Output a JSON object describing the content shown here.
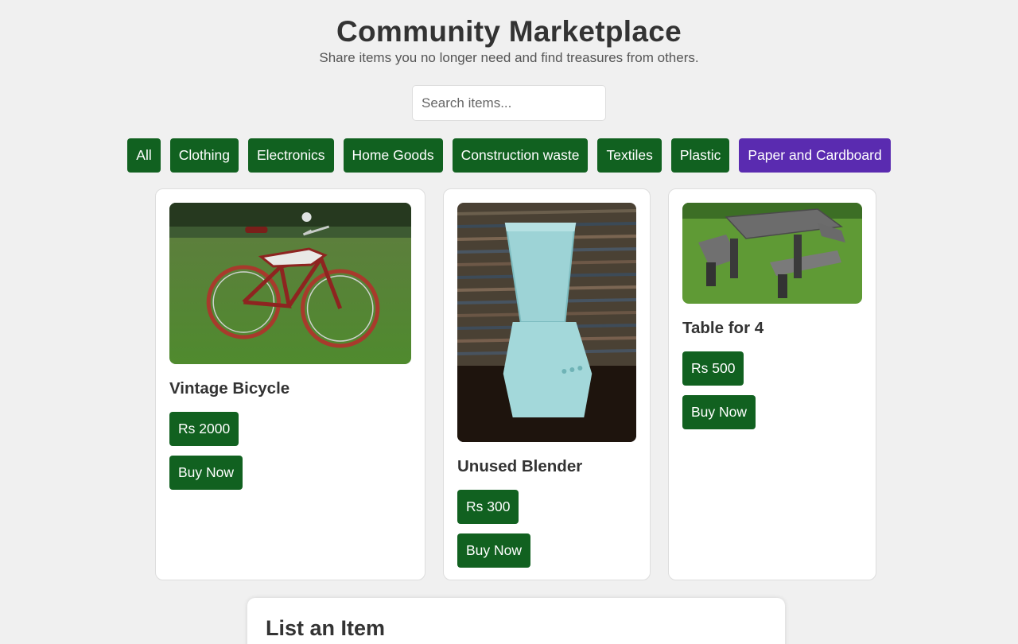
{
  "header": {
    "title": "Community Marketplace",
    "subtitle": "Share items you no longer need and find treasures from others."
  },
  "search": {
    "placeholder": "Search items...",
    "value": ""
  },
  "filters": [
    {
      "label": "All",
      "active": false
    },
    {
      "label": "Clothing",
      "active": false
    },
    {
      "label": "Electronics",
      "active": false
    },
    {
      "label": "Home Goods",
      "active": false
    },
    {
      "label": "Construction waste",
      "active": false
    },
    {
      "label": "Textiles",
      "active": false
    },
    {
      "label": "Plastic",
      "active": false
    },
    {
      "label": "Paper and Cardboard",
      "active": true
    }
  ],
  "items": [
    {
      "title": "Vintage Bicycle",
      "price": "Rs 2000",
      "buy_label": "Buy Now",
      "image": "bicycle-image"
    },
    {
      "title": "Unused Blender",
      "price": "Rs 300",
      "buy_label": "Buy Now",
      "image": "blender-image"
    },
    {
      "title": "Table for 4",
      "price": "Rs 500",
      "buy_label": "Buy Now",
      "image": "picnic-table-image"
    }
  ],
  "list_panel": {
    "title": "List an Item"
  },
  "colors": {
    "primary_green": "#116120",
    "active_purple": "#5a2bb0",
    "background": "#f0f0f0"
  }
}
